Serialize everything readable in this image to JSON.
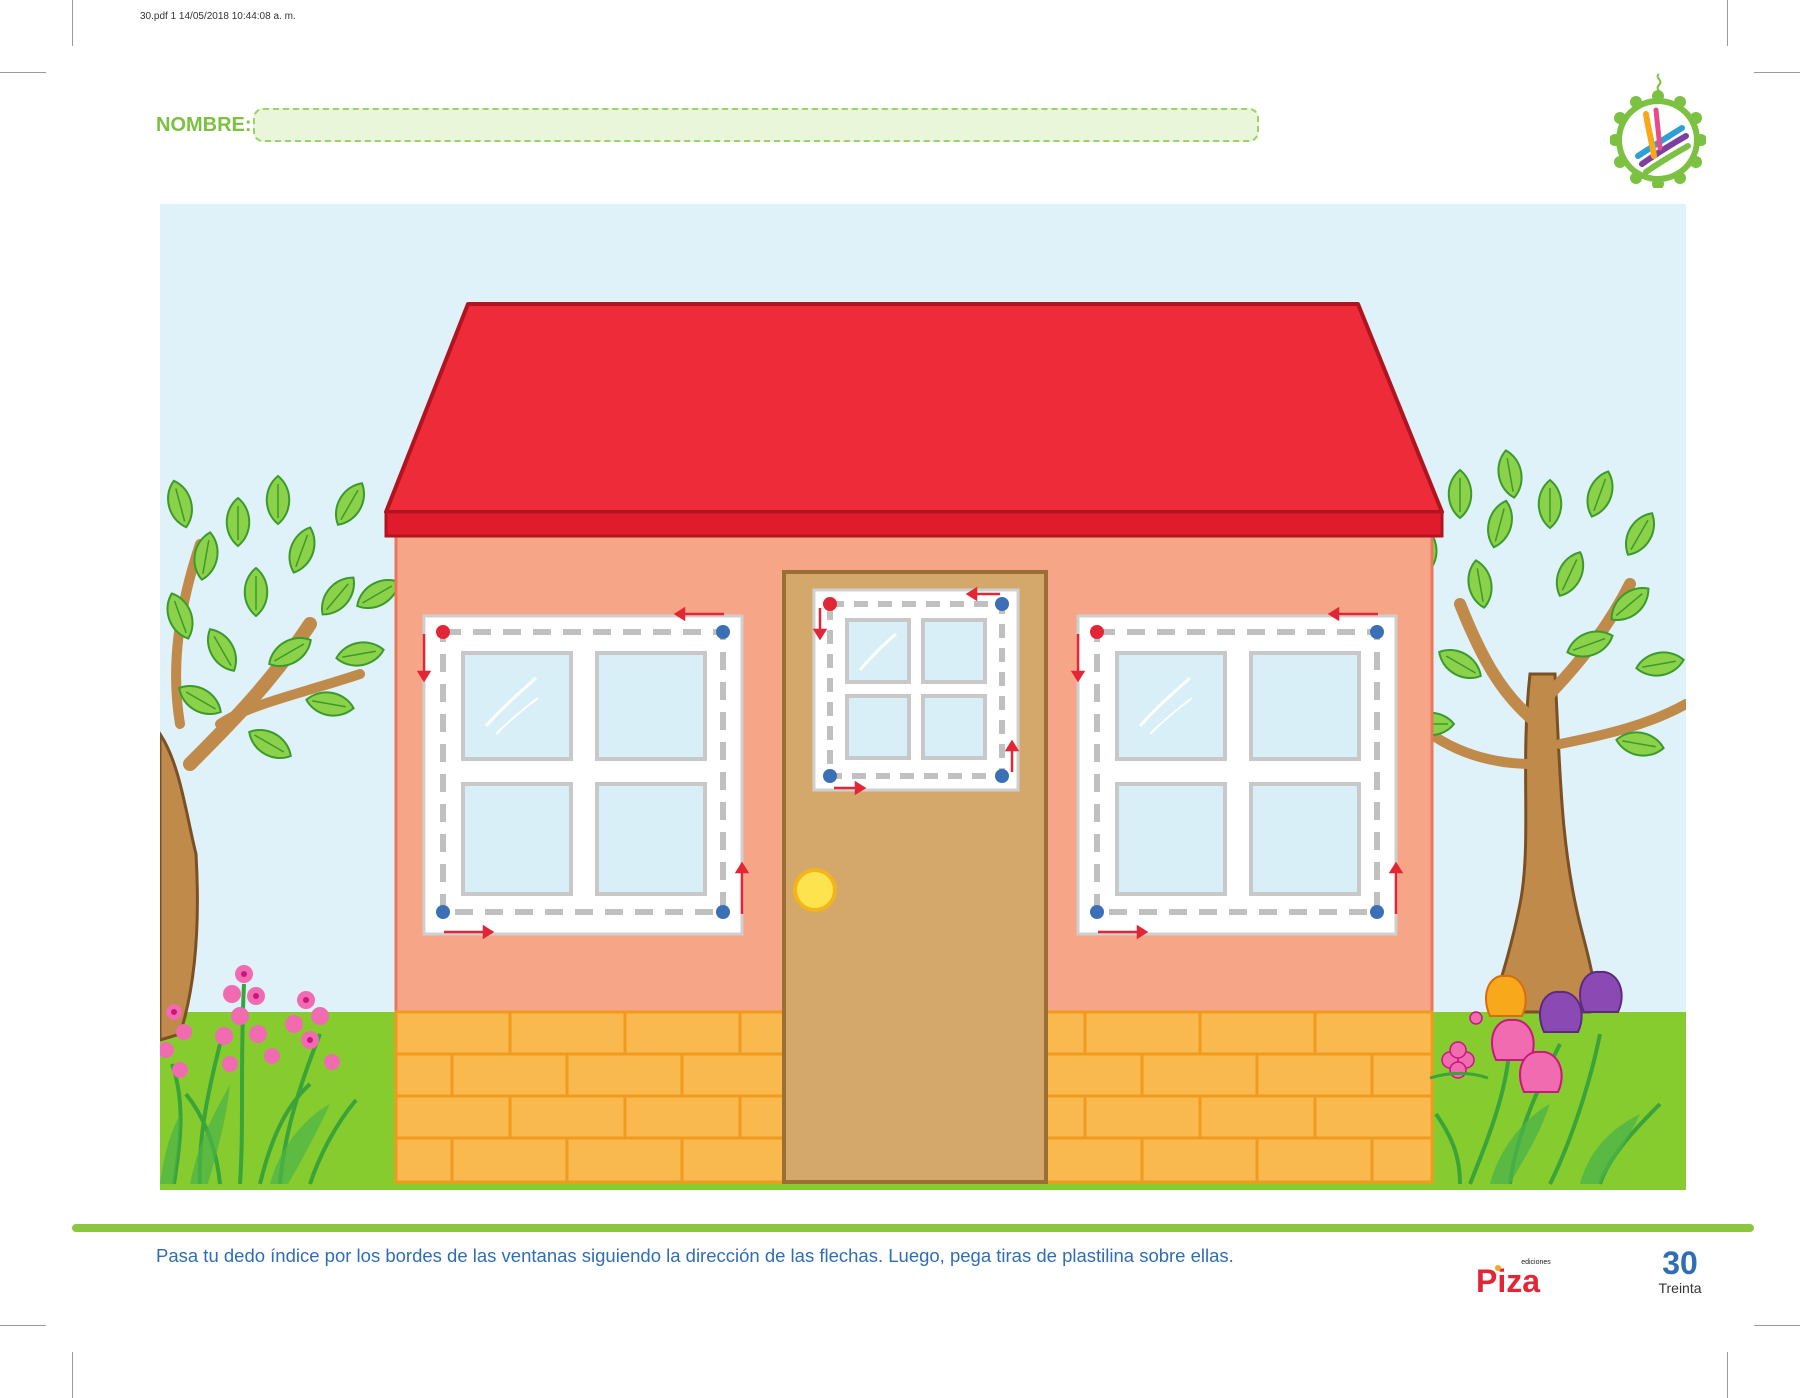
{
  "print_header": "30.pdf   1   14/05/2018   10:44:08 a. m.",
  "name_field": {
    "label": "NOMBRE:",
    "value": ""
  },
  "instruction": "Pasa tu dedo índice por los bordes de las ventanas siguiendo la dirección de las flechas. Luego, pega tiras de plastilina sobre ellas.",
  "publisher": {
    "small": "ediciones",
    "name": "Piza"
  },
  "page": {
    "number": "30",
    "word": "Treinta"
  },
  "colors": {
    "green_accent": "#7cc142",
    "blue_text": "#2f6eb5",
    "roof": "#ed2b39",
    "wall": "#f6a686",
    "door": "#d3a86a",
    "brick": "#f9b94f",
    "sky": "#dff1f9",
    "grass": "#87cc2e",
    "start_dot": "#e32636",
    "corner_dot": "#3b6fb6",
    "arrow": "#e32636"
  },
  "icons": [
    "plasticine-activity-icon",
    "door-knob-icon",
    "start-dot-icon",
    "corner-dot-icon",
    "direction-arrow-icon",
    "tree-icon",
    "flowers-icon",
    "tulips-icon"
  ]
}
